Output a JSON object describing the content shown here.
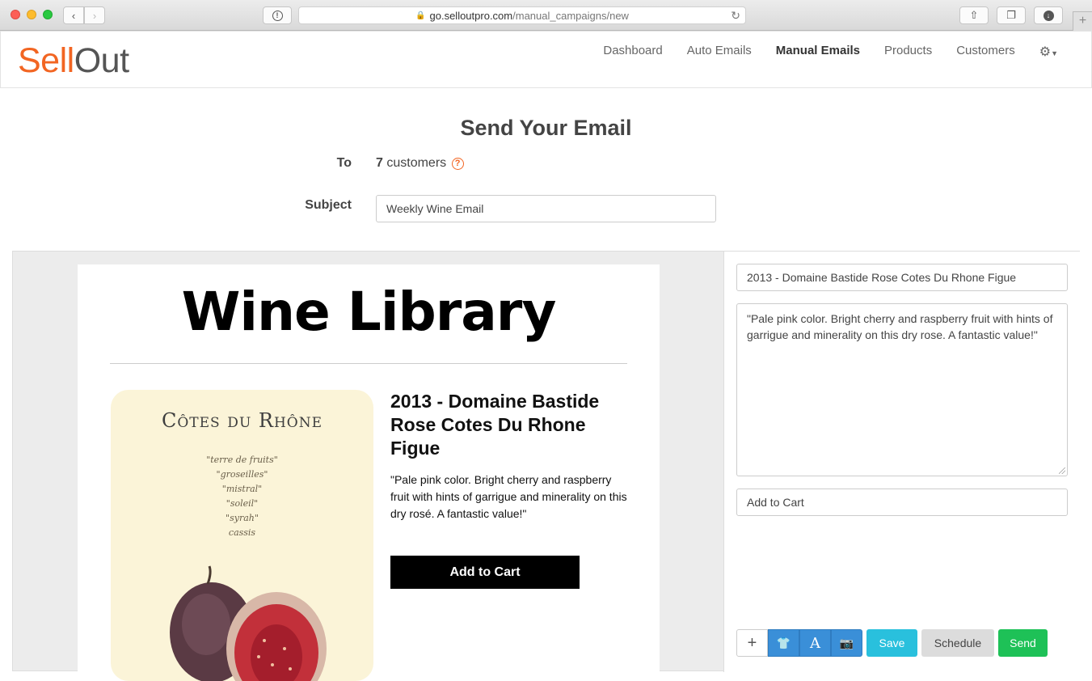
{
  "browser": {
    "url_domain": "go.selloutpro.com",
    "url_path": "/manual_campaigns/new"
  },
  "nav": {
    "logo_sell": "Sell",
    "logo_out": "Out",
    "links": [
      "Dashboard",
      "Auto Emails",
      "Manual Emails",
      "Products",
      "Customers"
    ],
    "active": "Manual Emails",
    "brand_color": "#f26522"
  },
  "form": {
    "title": "Send Your Email",
    "to_label": "To",
    "to_count": "7",
    "to_suffix": "customers",
    "subject_label": "Subject",
    "subject_value": "Weekly Wine Email"
  },
  "email_preview": {
    "brand": "Wine Library",
    "label_title": "Côtes du Rhône",
    "label_lines": [
      "\"terre de fruits\"",
      "\"groseilles\"",
      "\"mistral\"",
      "\"soleil\"",
      "\"syrah\"",
      "cassis"
    ],
    "product_name": "2013 - Domaine Bastide Rose Cotes Du Rhone Figue",
    "product_desc": "\"Pale pink color. Bright cherry and raspberry fruit with hints of garrigue and minerality on this dry rosé. A fantastic value!\"",
    "cart_label": "Add to Cart"
  },
  "panel": {
    "title_value": "2013 - Domaine Bastide Rose Cotes Du Rhone Figue",
    "desc_value": "\"Pale pink color. Bright cherry and raspberry fruit with hints of garrigue and minerality on this dry rose. A fantastic value!\"",
    "button_value": "Add to Cart",
    "save_label": "Save",
    "schedule_label": "Schedule",
    "send_label": "Send",
    "icons": [
      "plus-icon",
      "shirt-icon",
      "text-icon",
      "camera-icon"
    ]
  }
}
